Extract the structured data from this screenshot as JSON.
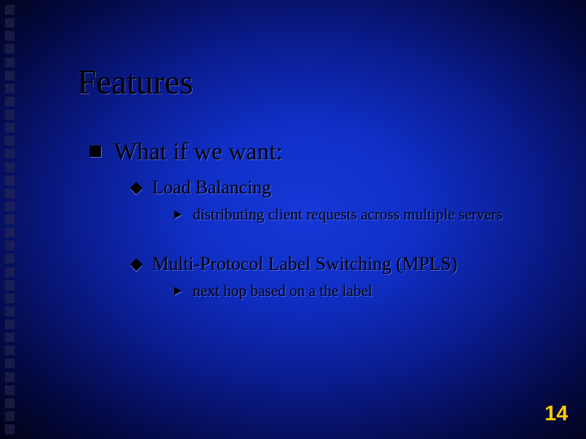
{
  "title": "Features",
  "bullets": {
    "l1_a": "What if we want:",
    "l2_a": "Load Balancing",
    "l3_a": "distributing client requests across multiple servers",
    "l2_b": "Multi-Protocol Label Switching (MPLS)",
    "l3_b": "next hop based on a the label"
  },
  "page_number": "14"
}
